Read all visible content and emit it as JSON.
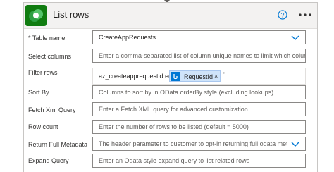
{
  "header": {
    "title": "List rows"
  },
  "rows": [
    {
      "label": "* Table name",
      "value": "CreateAppRequests",
      "placeholder": ""
    },
    {
      "label": "Select columns",
      "value": "",
      "placeholder": "Enter a comma-separated list of column unique names to limit which columns a"
    },
    {
      "label": "Filter rows",
      "expression": "az_createapprequestid  eq",
      "token": "RequestId",
      "token_close": "×",
      "caret": "'"
    },
    {
      "label": "Sort By",
      "value": "",
      "placeholder": "Columns to sort by in OData orderBy style (excluding lookups)"
    },
    {
      "label": "Fetch Xml Query",
      "value": "",
      "placeholder": "Enter a Fetch XML query for advanced customization"
    },
    {
      "label": "Row count",
      "value": "",
      "placeholder": "Enter the number of rows to be listed (default = 5000)"
    },
    {
      "label": "Return Full Metadata",
      "value": "",
      "placeholder": "The header parameter to customer to opt-in returning full odata metadat"
    },
    {
      "label": "Expand Query",
      "value": "",
      "placeholder": "Enter an Odata style expand query to list related rows"
    }
  ],
  "colors": {
    "accent": "#0078d4",
    "dataverse_green": "#107c10",
    "token_background": "#cfe4fa"
  }
}
